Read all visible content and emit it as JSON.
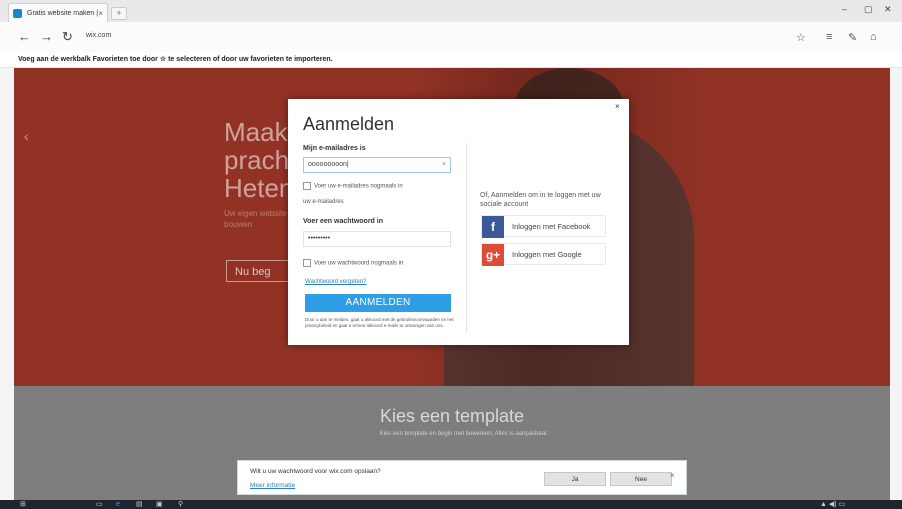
{
  "browser": {
    "tab_title": "Gratis website maken | ",
    "tab_close": "×",
    "new_tab": "+",
    "window_controls": [
      "–",
      "▢",
      "✕"
    ],
    "nav": {
      "back": "←",
      "forward": "→",
      "reload": "↻"
    },
    "url": "wix.com",
    "toolbar_icons": [
      "star-icon",
      "reading-list-icon",
      "notes-icon",
      "share-icon"
    ],
    "favorites_bar_text": "Voeg aan de werkbalk Favorieten toe door ☆ te selecteren of door uw favorieten te importeren."
  },
  "hero": {
    "heading": "Maak prach Heten",
    "subtext": "Uw eigen website bouwen",
    "button_label": "Nu beg"
  },
  "lower_section": {
    "title": "Kies een template",
    "description": "Kies een template en begin met bewerken. Alles is aanpasbaar."
  },
  "modal": {
    "title": "Aanmelden",
    "close": "×",
    "email_label": "Mijn e-mailadres is",
    "email_value": "ooooooooon|",
    "email_clear": "×",
    "remember_email": "Voer uw e-mailadres nogmaals in",
    "remember_email_2": "uw e-mailadres",
    "password_label": "Voer een wachtwoord in",
    "password_value": "•••••••••",
    "remember_password": "Voer uw wachtwoord nogmaals in",
    "forgot_link": "Wachtwoord vergeten?",
    "submit_label": "AANMELDEN",
    "terms_text": "Door u aan te melden, gaat u akkoord met de gebruiksvoorwaarden en het privacybeleid en gaat u ermee akkoord e-mails te ontvangen van ons.",
    "social_intro": "Of, Aanmelden om in te loggen met uw sociale account",
    "facebook_label": "Inloggen met Facebook",
    "facebook_icon": "f",
    "google_label": "Inloggen met Google",
    "google_icon": "g+",
    "colors": {
      "facebook": "#3b5998",
      "google": "#dd4b39",
      "submit": "#2f9ee6"
    }
  },
  "password_bar": {
    "text": "Wilt u uw wachtwoord voor wix.com opslaan?",
    "link": "Meer informatie",
    "yes": "Ja",
    "no": "Nee",
    "close": "×"
  },
  "taskbar": {
    "icons": [
      "windows-icon",
      "search-icon",
      "task-view-icon",
      "edge-icon",
      "explorer-icon",
      "store-icon"
    ],
    "tray": "▲  ◀)  ▭"
  }
}
